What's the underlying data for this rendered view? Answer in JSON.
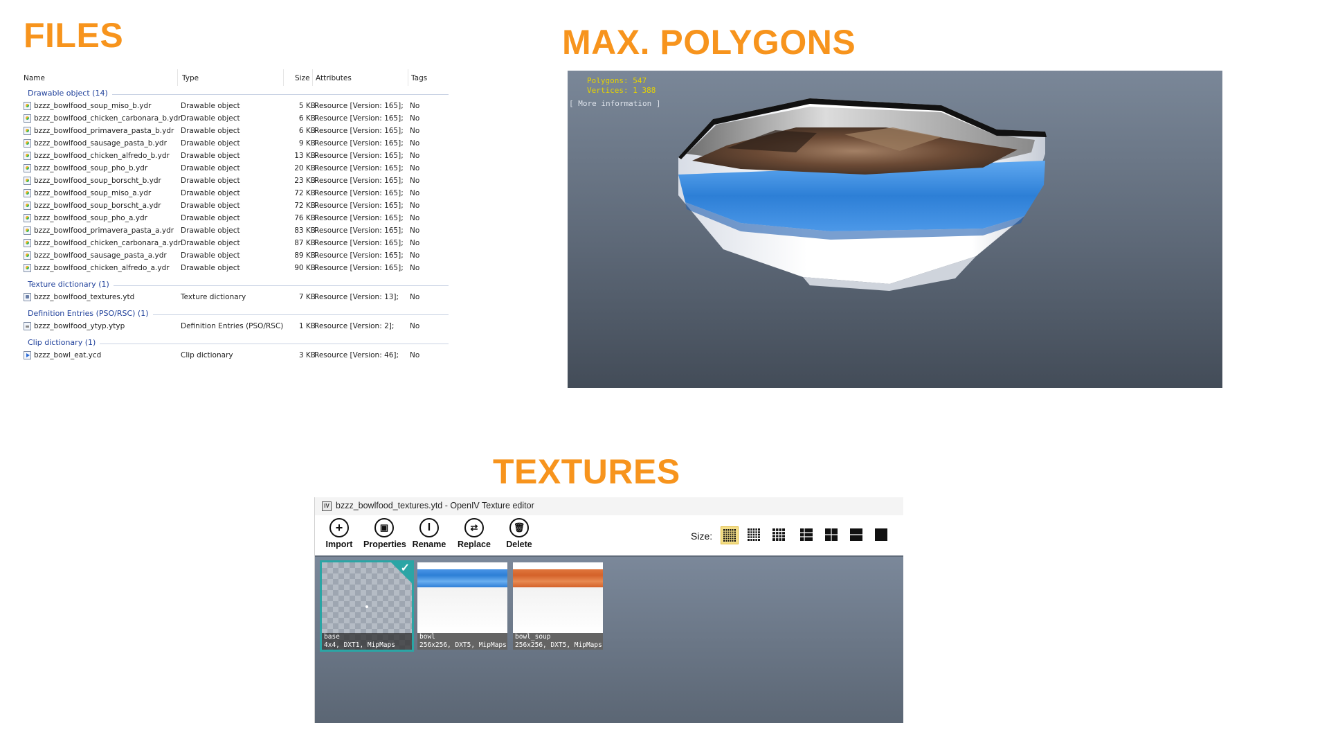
{
  "headings": {
    "files": "FILES",
    "max_polygons": "MAX. POLYGONS",
    "textures": "TEXTURES"
  },
  "colors": {
    "heading": "#f7941d",
    "group_label": "#1e3f9a",
    "selection": "#2ba5a5",
    "stats_text": "#e6d300",
    "bowl_band_blue": "#2d7fd6",
    "bowl_band_orange": "#d4622a"
  },
  "files": {
    "columns": [
      "Name",
      "Type",
      "Size",
      "Attributes",
      "Tags"
    ],
    "groups": [
      {
        "label": "Drawable object (14)",
        "icon": "drawable-icon",
        "rows": [
          {
            "name": "bzzz_bowlfood_soup_miso_b.ydr",
            "type": "Drawable object",
            "size": "5 KB",
            "attributes": "Resource [Version: 165];",
            "tags": "No"
          },
          {
            "name": "bzzz_bowlfood_chicken_carbonara_b.ydr",
            "type": "Drawable object",
            "size": "6 KB",
            "attributes": "Resource [Version: 165];",
            "tags": "No"
          },
          {
            "name": "bzzz_bowlfood_primavera_pasta_b.ydr",
            "type": "Drawable object",
            "size": "6 KB",
            "attributes": "Resource [Version: 165];",
            "tags": "No"
          },
          {
            "name": "bzzz_bowlfood_sausage_pasta_b.ydr",
            "type": "Drawable object",
            "size": "9 KB",
            "attributes": "Resource [Version: 165];",
            "tags": "No"
          },
          {
            "name": "bzzz_bowlfood_chicken_alfredo_b.ydr",
            "type": "Drawable object",
            "size": "13 KB",
            "attributes": "Resource [Version: 165];",
            "tags": "No"
          },
          {
            "name": "bzzz_bowlfood_soup_pho_b.ydr",
            "type": "Drawable object",
            "size": "20 KB",
            "attributes": "Resource [Version: 165];",
            "tags": "No"
          },
          {
            "name": "bzzz_bowlfood_soup_borscht_b.ydr",
            "type": "Drawable object",
            "size": "23 KB",
            "attributes": "Resource [Version: 165];",
            "tags": "No"
          },
          {
            "name": "bzzz_bowlfood_soup_miso_a.ydr",
            "type": "Drawable object",
            "size": "72 KB",
            "attributes": "Resource [Version: 165];",
            "tags": "No"
          },
          {
            "name": "bzzz_bowlfood_soup_borscht_a.ydr",
            "type": "Drawable object",
            "size": "72 KB",
            "attributes": "Resource [Version: 165];",
            "tags": "No"
          },
          {
            "name": "bzzz_bowlfood_soup_pho_a.ydr",
            "type": "Drawable object",
            "size": "76 KB",
            "attributes": "Resource [Version: 165];",
            "tags": "No"
          },
          {
            "name": "bzzz_bowlfood_primavera_pasta_a.ydr",
            "type": "Drawable object",
            "size": "83 KB",
            "attributes": "Resource [Version: 165];",
            "tags": "No"
          },
          {
            "name": "bzzz_bowlfood_chicken_carbonara_a.ydr",
            "type": "Drawable object",
            "size": "87 KB",
            "attributes": "Resource [Version: 165];",
            "tags": "No"
          },
          {
            "name": "bzzz_bowlfood_sausage_pasta_a.ydr",
            "type": "Drawable object",
            "size": "89 KB",
            "attributes": "Resource [Version: 165];",
            "tags": "No"
          },
          {
            "name": "bzzz_bowlfood_chicken_alfredo_a.ydr",
            "type": "Drawable object",
            "size": "90 KB",
            "attributes": "Resource [Version: 165];",
            "tags": "No"
          }
        ]
      },
      {
        "label": "Texture dictionary (1)",
        "icon": "texture-dictionary-icon",
        "rows": [
          {
            "name": "bzzz_bowlfood_textures.ytd",
            "type": "Texture dictionary",
            "size": "7 KB",
            "attributes": "Resource [Version: 13];",
            "tags": "No"
          }
        ]
      },
      {
        "label": "Definition Entries (PSO/RSC) (1)",
        "icon": "definition-file-icon",
        "rows": [
          {
            "name": "bzzz_bowlfood_ytyp.ytyp",
            "type": "Definition Entries (PSO/RSC)",
            "size": "1 KB",
            "attributes": "Resource [Version: 2];",
            "tags": "No"
          }
        ]
      },
      {
        "label": "Clip dictionary (1)",
        "icon": "clip-dictionary-icon",
        "rows": [
          {
            "name": "bzzz_bowl_eat.ycd",
            "type": "Clip dictionary",
            "size": "3 KB",
            "attributes": "Resource [Version: 46];",
            "tags": "No"
          }
        ]
      }
    ]
  },
  "viewport": {
    "polygons": "Polygons: 547",
    "vertices": "Vertices: 1 388",
    "more_info": "[ More information ]"
  },
  "texture_editor": {
    "title": "bzzz_bowlfood_textures.ytd - OpenIV Texture editor",
    "app_icon": "IV",
    "toolbar": [
      {
        "label": "Import",
        "icon": "plus-icon"
      },
      {
        "label": "Properties",
        "icon": "properties-icon"
      },
      {
        "label": "Rename",
        "icon": "rename-icon"
      },
      {
        "label": "Replace",
        "icon": "replace-icon"
      },
      {
        "label": "Delete",
        "icon": "trash-icon"
      }
    ],
    "size_label": "Size:",
    "size_options": [
      "grid-fine-icon",
      "grid-medium-icon",
      "grid-coarse-icon",
      "list-icon",
      "tiles-icon",
      "wide-icon",
      "large-icon"
    ],
    "textures": [
      {
        "name": "base",
        "info": "4x4, DXT1, MipMaps",
        "selected": true
      },
      {
        "name": "bowl",
        "info": "256x256, DXT5, MipMaps",
        "selected": false,
        "band_color": "#2d7fd6"
      },
      {
        "name": "bowl_soup",
        "info": "256x256, DXT5, MipMaps",
        "selected": false,
        "band_color": "#d4622a"
      }
    ]
  }
}
